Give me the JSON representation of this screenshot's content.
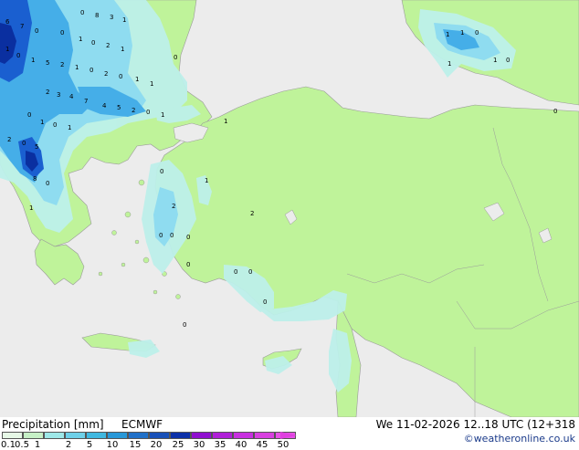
{
  "footer": {
    "title": "Precipitation [mm]",
    "model": "ECMWF",
    "datetime": "We 11-02-2026 12..18 UTC (12+318",
    "credit": "©weatheronline.co.uk"
  },
  "legend": {
    "labels": [
      "0.1",
      "0.5",
      "1",
      "2",
      "5",
      "10",
      "15",
      "20",
      "25",
      "30",
      "35",
      "40",
      "45",
      "50"
    ],
    "colors": [
      "#e6f8e6",
      "#c6f0c6",
      "#9ee8e8",
      "#6ed0e8",
      "#40b8e0",
      "#2898d8",
      "#2070c8",
      "#1850b8",
      "#0c30a8",
      "#9010d0",
      "#b020d8",
      "#c830e0",
      "#d840e0",
      "#e850e8"
    ],
    "arrow_color": "#e040e0"
  },
  "map_colors": {
    "sea": "#ececec",
    "land": "#bff39a",
    "light_precip": "#bdf0ea",
    "moderate_precip": "#8fdcf0",
    "heavy_precip": "#45aee8",
    "intense_precip": "#1a5fd0",
    "extreme_precip": "#0a2fa0",
    "border": "#9a9a9a"
  },
  "value_labels": [
    "6",
    "7",
    "0",
    "0",
    "8",
    "3",
    "1",
    "1",
    "0",
    "1",
    "5",
    "2",
    "1",
    "0",
    "2",
    "0",
    "1",
    "1",
    "4",
    "5",
    "2",
    "0",
    "1",
    "2",
    "3",
    "4",
    "7",
    "0",
    "1",
    "0",
    "1",
    "2",
    "0",
    "5",
    "8",
    "0",
    "1",
    "0",
    "1",
    "0",
    "2",
    "1",
    "0",
    "1",
    "1",
    "1",
    "0",
    "1",
    "1",
    "0",
    "0",
    "1",
    "2",
    "2",
    "0",
    "0",
    "0",
    "0",
    "0",
    "0",
    "0",
    "0",
    "0"
  ]
}
